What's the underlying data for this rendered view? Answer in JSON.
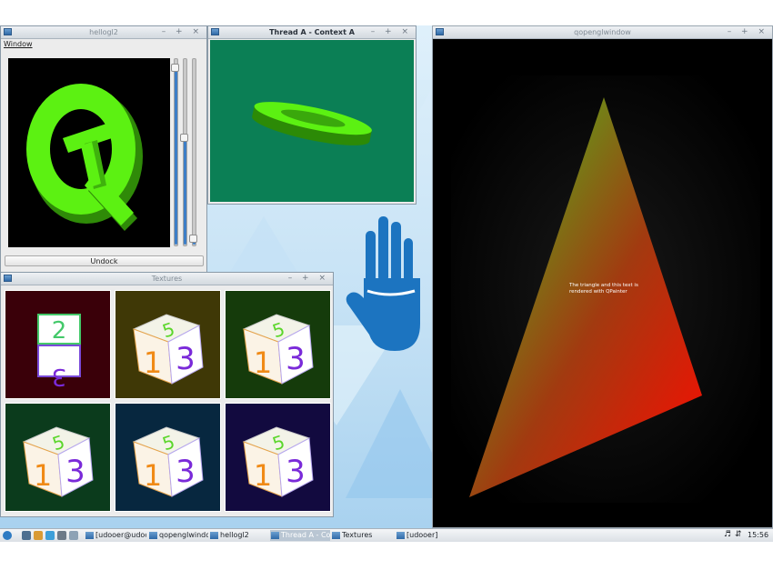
{
  "windows": {
    "hellogl2": {
      "title": "hellogl2",
      "menu": "Window",
      "undock_button": "Undock",
      "logo_text": "Qt",
      "sliders": [
        {
          "level": 0.97
        },
        {
          "level": 0.58
        },
        {
          "level": 0.02
        }
      ]
    },
    "thread_a": {
      "title": "Thread A - Context A",
      "background": "#0b7f55"
    },
    "qopenglwindow": {
      "title": "qopenglwindow",
      "painter_text": "The triangle and this text is rendered with QPainter",
      "gradient_top": "#3fcf1e",
      "gradient_bottom": "#ff0a00"
    },
    "textures": {
      "title": "Textures",
      "tiles": [
        {
          "bg": "#3a0009",
          "faces": [
            "2",
            "3"
          ],
          "kind": "flat"
        },
        {
          "bg": "#3f3806",
          "faces": [
            "5",
            "1",
            "3"
          ],
          "kind": "cube"
        },
        {
          "bg": "#153b0b",
          "faces": [
            "5",
            "1",
            "3"
          ],
          "kind": "cube"
        },
        {
          "bg": "#0b3b1c",
          "faces": [
            "5",
            "1",
            "3"
          ],
          "kind": "cube"
        },
        {
          "bg": "#07273f",
          "faces": [
            "5",
            "1",
            "3"
          ],
          "kind": "cube"
        },
        {
          "bg": "#120a3f",
          "faces": [
            "5",
            "1",
            "3"
          ],
          "kind": "cube"
        }
      ]
    }
  },
  "window_controls": "– + ×",
  "taskbar": {
    "tasks": [
      {
        "label": "[udooer@udoo...",
        "active": false
      },
      {
        "label": "qopenglwindow",
        "active": false
      },
      {
        "label": "hellogl2",
        "active": false
      },
      {
        "label": "Thread A - Cont...",
        "active": true
      },
      {
        "label": "Textures",
        "active": false
      },
      {
        "label": "[udooer]",
        "active": false
      }
    ],
    "clock": "15:56",
    "tray_icons": [
      "volume-icon",
      "network-icon"
    ]
  },
  "colors": {
    "qt_green": "#5cf112",
    "hand_blue": "#1c74c0"
  }
}
